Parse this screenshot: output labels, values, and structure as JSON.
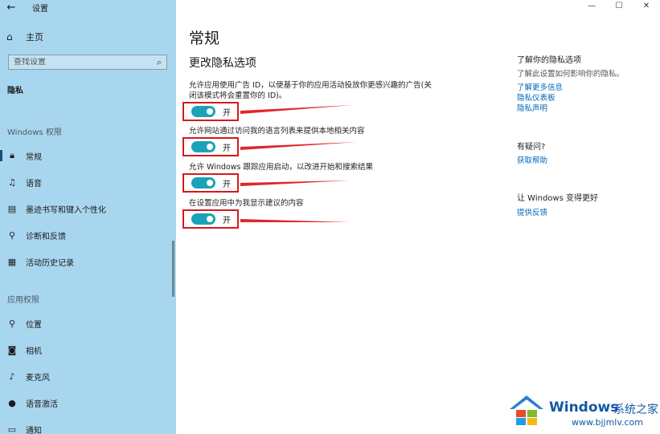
{
  "app": {
    "title": "设置"
  },
  "sidebar": {
    "home_label": "主页",
    "search_placeholder": "查找设置",
    "current_section": "隐私",
    "group_windows": "Windows 权限",
    "windows_items": [
      {
        "label": "常规",
        "icon": "lock-icon"
      },
      {
        "label": "语音",
        "icon": "speech-icon"
      },
      {
        "label": "墨迹书写和键入个性化",
        "icon": "ink-icon"
      },
      {
        "label": "诊断和反馈",
        "icon": "feedback-icon"
      },
      {
        "label": "活动历史记录",
        "icon": "history-icon"
      }
    ],
    "group_app": "应用权限",
    "app_items": [
      {
        "label": "位置",
        "icon": "location-icon"
      },
      {
        "label": "相机",
        "icon": "camera-icon"
      },
      {
        "label": "麦克风",
        "icon": "microphone-icon"
      },
      {
        "label": "语音激活",
        "icon": "voice-activation-icon"
      },
      {
        "label": "通知",
        "icon": "notification-icon"
      }
    ]
  },
  "main": {
    "title": "常规",
    "subtitle": "更改隐私选项",
    "settings": [
      {
        "desc": "允许应用使用广告 ID，以便基于你的应用活动投放你更感兴趣的广告(关闭该模式将会重置你的 ID)。",
        "state": "开",
        "on": true
      },
      {
        "desc": "允许网站通过访问我的语言列表来提供本地相关内容",
        "state": "开",
        "on": true
      },
      {
        "desc": "允许 Windows 跟踪应用启动，以改进开始和搜索结果",
        "state": "开",
        "on": true
      },
      {
        "desc": "在设置应用中为我显示建议的内容",
        "state": "开",
        "on": true
      }
    ]
  },
  "right": {
    "know_heading": "了解你的隐私选项",
    "know_text": "了解此设置如何影响你的隐私。",
    "links": [
      "了解更多信息",
      "隐私仪表板",
      "隐私声明"
    ],
    "question_heading": "有疑问?",
    "help_link": "获取帮助",
    "improve_heading": "让 Windows 变得更好",
    "feedback_link": "提供反馈"
  },
  "watermark": {
    "brand": "Windows",
    "site_name": "系统之家",
    "url": "www.bjjmlv.com"
  },
  "colors": {
    "sidebar_bg": "#a9d6ef",
    "toggle_on": "#1aa3b7",
    "highlight": "#d7191c",
    "link": "#0067b8"
  }
}
